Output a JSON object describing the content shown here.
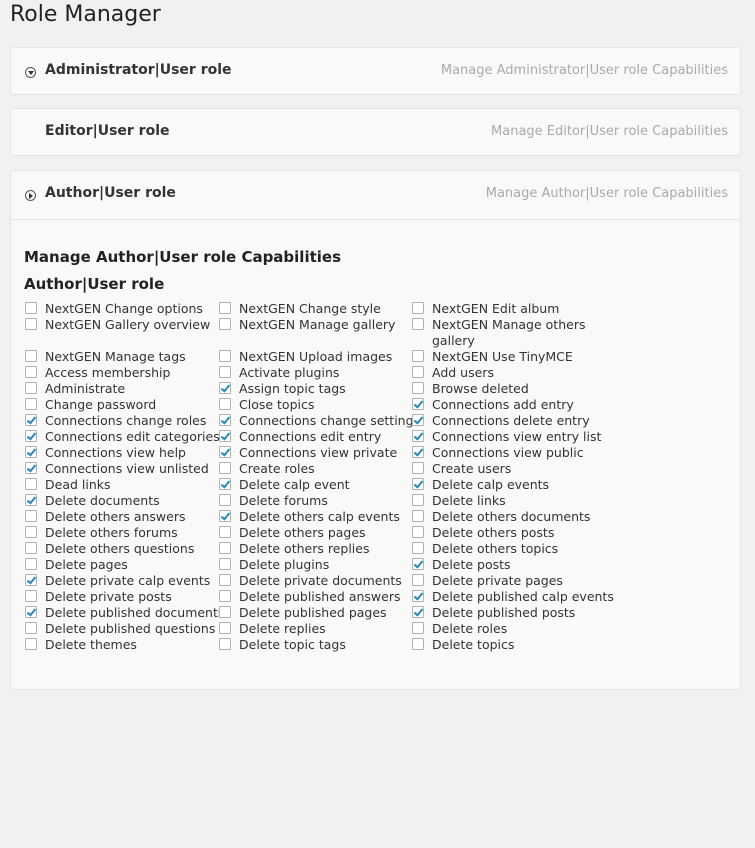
{
  "page": {
    "title": "Role Manager"
  },
  "roles": [
    {
      "title": "Administrator|User role",
      "link": "Manage Administrator|User role Capabilities",
      "expanded": false
    },
    {
      "title": "Editor|User role",
      "link": "Manage Editor|User role Capabilities",
      "expanded": false
    },
    {
      "title": "Author|User role",
      "link": "Manage Author|User role Capabilities",
      "expanded": true
    }
  ],
  "author_panel": {
    "section_title": "Manage Author|User role Capabilities",
    "role_name": "Author|User role",
    "capabilities": [
      {
        "label": "NextGEN Change options",
        "checked": false
      },
      {
        "label": "NextGEN Change style",
        "checked": false
      },
      {
        "label": "NextGEN Edit album",
        "checked": false
      },
      {
        "label": "NextGEN Gallery overview",
        "checked": false
      },
      {
        "label": "NextGEN Manage gallery",
        "checked": false
      },
      {
        "label": "NextGEN Manage others gallery",
        "checked": false
      },
      {
        "label": "NextGEN Manage tags",
        "checked": false
      },
      {
        "label": "NextGEN Upload images",
        "checked": false
      },
      {
        "label": "NextGEN Use TinyMCE",
        "checked": false
      },
      {
        "label": "Access membership",
        "checked": false
      },
      {
        "label": "Activate plugins",
        "checked": false
      },
      {
        "label": "Add users",
        "checked": false
      },
      {
        "label": "Administrate",
        "checked": false
      },
      {
        "label": "Assign topic tags",
        "checked": true
      },
      {
        "label": "Browse deleted",
        "checked": false
      },
      {
        "label": "Change password",
        "checked": false
      },
      {
        "label": "Close topics",
        "checked": false
      },
      {
        "label": "Connections add entry",
        "checked": true
      },
      {
        "label": "Connections change roles",
        "checked": true
      },
      {
        "label": "Connections change settings",
        "checked": true
      },
      {
        "label": "Connections delete entry",
        "checked": true
      },
      {
        "label": "Connections edit categories",
        "checked": true
      },
      {
        "label": "Connections edit entry",
        "checked": true
      },
      {
        "label": "Connections view entry list",
        "checked": true
      },
      {
        "label": "Connections view help",
        "checked": true
      },
      {
        "label": "Connections view private",
        "checked": true
      },
      {
        "label": "Connections view public",
        "checked": true
      },
      {
        "label": "Connections view unlisted",
        "checked": true
      },
      {
        "label": "Create roles",
        "checked": false
      },
      {
        "label": "Create users",
        "checked": false
      },
      {
        "label": "Dead links",
        "checked": false
      },
      {
        "label": "Delete calp event",
        "checked": true
      },
      {
        "label": "Delete calp events",
        "checked": true
      },
      {
        "label": "Delete documents",
        "checked": true
      },
      {
        "label": "Delete forums",
        "checked": false
      },
      {
        "label": "Delete links",
        "checked": false
      },
      {
        "label": "Delete others answers",
        "checked": false
      },
      {
        "label": "Delete others calp events",
        "checked": true
      },
      {
        "label": "Delete others documents",
        "checked": false
      },
      {
        "label": "Delete others forums",
        "checked": false
      },
      {
        "label": "Delete others pages",
        "checked": false
      },
      {
        "label": "Delete others posts",
        "checked": false
      },
      {
        "label": "Delete others questions",
        "checked": false
      },
      {
        "label": "Delete others replies",
        "checked": false
      },
      {
        "label": "Delete others topics",
        "checked": false
      },
      {
        "label": "Delete pages",
        "checked": false
      },
      {
        "label": "Delete plugins",
        "checked": false
      },
      {
        "label": "Delete posts",
        "checked": true
      },
      {
        "label": "Delete private calp events",
        "checked": true
      },
      {
        "label": "Delete private documents",
        "checked": false
      },
      {
        "label": "Delete private pages",
        "checked": false
      },
      {
        "label": "Delete private posts",
        "checked": false
      },
      {
        "label": "Delete published answers",
        "checked": false
      },
      {
        "label": "Delete published calp events",
        "checked": true
      },
      {
        "label": "Delete published documents",
        "checked": true
      },
      {
        "label": "Delete published pages",
        "checked": false
      },
      {
        "label": "Delete published posts",
        "checked": true
      },
      {
        "label": "Delete published questions",
        "checked": false
      },
      {
        "label": "Delete replies",
        "checked": false
      },
      {
        "label": "Delete roles",
        "checked": false
      },
      {
        "label": "Delete themes",
        "checked": false
      },
      {
        "label": "Delete topic tags",
        "checked": false
      },
      {
        "label": "Delete topics",
        "checked": false
      }
    ]
  }
}
